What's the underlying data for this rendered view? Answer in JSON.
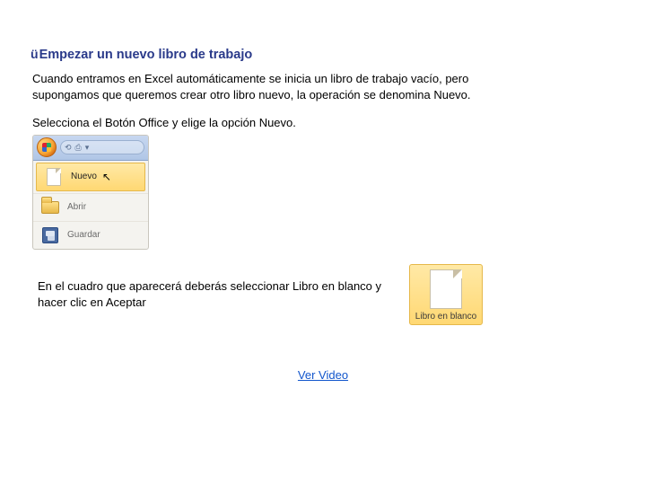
{
  "heading": {
    "bullet": "ü",
    "text": "Empezar un nuevo libro de trabajo"
  },
  "paragraph1": "Cuando entramos en Excel automáticamente se inicia un libro de trabajo vacío, pero supongamos que queremos crear otro libro nuevo, la operación se denomina Nuevo.",
  "paragraph2": "Selecciona el Botón Office y elige la opción Nuevo.",
  "menu": {
    "items": [
      {
        "label": "Nuevo",
        "icon": "new",
        "active": true
      },
      {
        "label": "Abrir",
        "icon": "open",
        "active": false
      },
      {
        "label": "Guardar",
        "icon": "save",
        "active": false
      }
    ]
  },
  "paragraph3": "En el cuadro que aparecerá deberás seleccionar Libro en blanco y hacer clic en Aceptar",
  "tile": {
    "label": "Libro en blanco"
  },
  "link": {
    "label": "Ver Video"
  }
}
